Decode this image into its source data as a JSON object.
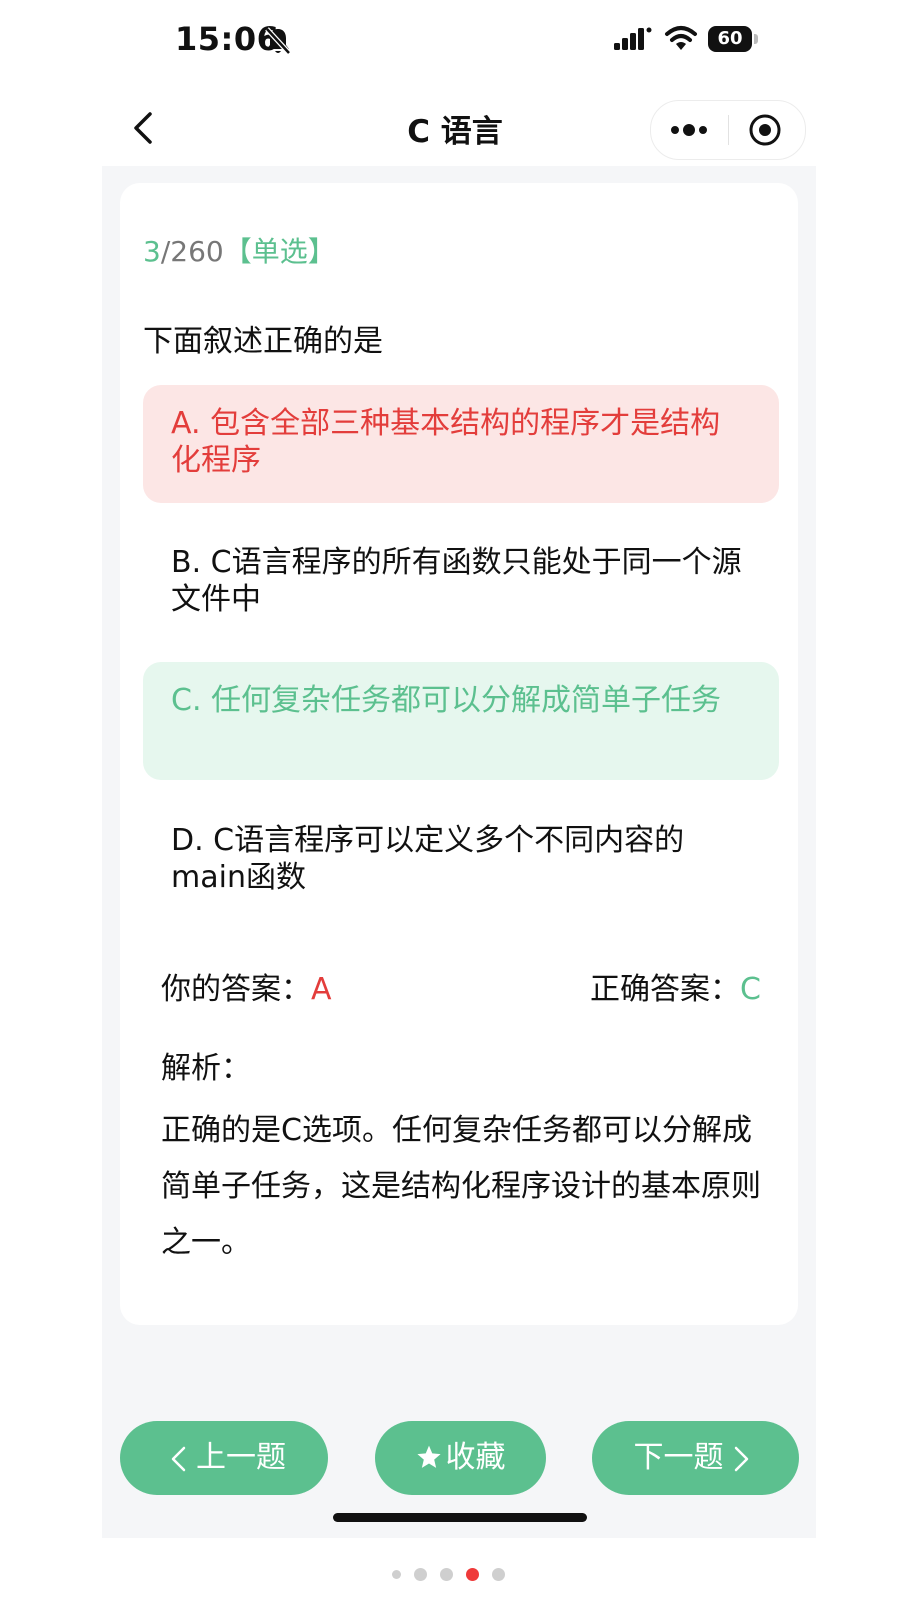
{
  "status_bar": {
    "time": "15:06",
    "battery": "60",
    "icons": [
      "bell-slash-icon",
      "signal-icon",
      "wifi-icon",
      "battery-icon"
    ]
  },
  "nav": {
    "title": "C 语言",
    "icons": [
      "back-icon",
      "more-icon",
      "close-miniprogram-icon"
    ]
  },
  "quiz": {
    "progress_current": "3",
    "progress_total": "/260",
    "question_type": "【单选】",
    "question": "下面叙述正确的是",
    "options": [
      {
        "label": "A. 包含全部三种基本结构的程序才是结构化程序",
        "state": "wrong"
      },
      {
        "label": "B. C语言程序的所有函数只能处于同一个源文件中",
        "state": "normal"
      },
      {
        "label": "C. 任何复杂任务都可以分解成简单子任务",
        "state": "correct"
      },
      {
        "label": "D. C语言程序可以定义多个不同内容的main函数",
        "state": "normal"
      }
    ],
    "your_answer_label": "你的答案：",
    "your_answer": "A",
    "correct_answer_label": "正确答案：",
    "correct_answer": "C",
    "analysis_title": "解析：",
    "analysis_text": "正确的是C选项。任何复杂任务都可以分解成简单子任务，这是结构化程序设计的基本原则之一。"
  },
  "buttons": {
    "prev": "上一题",
    "favorite": "收藏",
    "next": "下一题"
  },
  "colors": {
    "accent": "#5cc08f",
    "wrong": "#e33d3b",
    "wrong_bg": "#fce6e5",
    "correct_bg": "#e6f7ee",
    "active_dot": "#ef3a3a"
  },
  "carousel": {
    "total": 5,
    "active_index": 3
  }
}
